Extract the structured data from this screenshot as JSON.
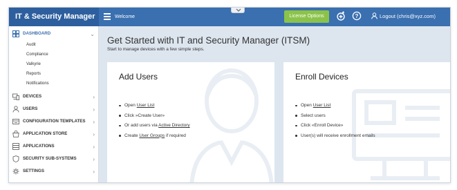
{
  "header": {
    "brand": "IT & Security Manager",
    "welcome": "Welcome",
    "license_button": "License Options",
    "logout": "Logout (chris@xyz.com)"
  },
  "sidebar": {
    "items": [
      {
        "label": "DASHBOARD",
        "icon": "dashboard-icon"
      },
      {
        "label": "DEVICES",
        "icon": "devices-icon"
      },
      {
        "label": "USERS",
        "icon": "users-icon"
      },
      {
        "label": "CONFIGURATION TEMPLATES",
        "icon": "templates-icon"
      },
      {
        "label": "APPLICATION STORE",
        "icon": "store-icon"
      },
      {
        "label": "APPLICATIONS",
        "icon": "applications-icon"
      },
      {
        "label": "SECURITY SUB-SYSTEMS",
        "icon": "shield-icon"
      },
      {
        "label": "SETTINGS",
        "icon": "gear-icon"
      }
    ],
    "dashboard_sub": [
      "Audit",
      "Compliance",
      "Valkyrie",
      "Reports",
      "Notifications"
    ]
  },
  "main": {
    "title": "Get Started with IT and Security Manager (ITSM)",
    "subtitle": "Start to manage devices with a few simple steps.",
    "add_users": {
      "title": "Add Users",
      "steps": {
        "s1_pre": "Open ",
        "s1_link": "User List",
        "s2": "Click »Create User»",
        "s3_pre": "Or add users via ",
        "s3_link": "Active Directory",
        "s4_pre": "Create ",
        "s4_link": "User Groups",
        "s4_post": " if required"
      }
    },
    "enroll": {
      "title": "Enroll Devices",
      "steps": {
        "s1_pre": "Open ",
        "s1_link": "User List",
        "s2": "Select users",
        "s3": "Click «Enroll Device»",
        "s4": "User(s) will receive enrollment emails"
      }
    }
  },
  "colors": {
    "topbar": "#3a6fb0",
    "brand_bg": "#2d5f9e",
    "license_button": "#8bc34a",
    "content_bg": "#dde6ef"
  }
}
